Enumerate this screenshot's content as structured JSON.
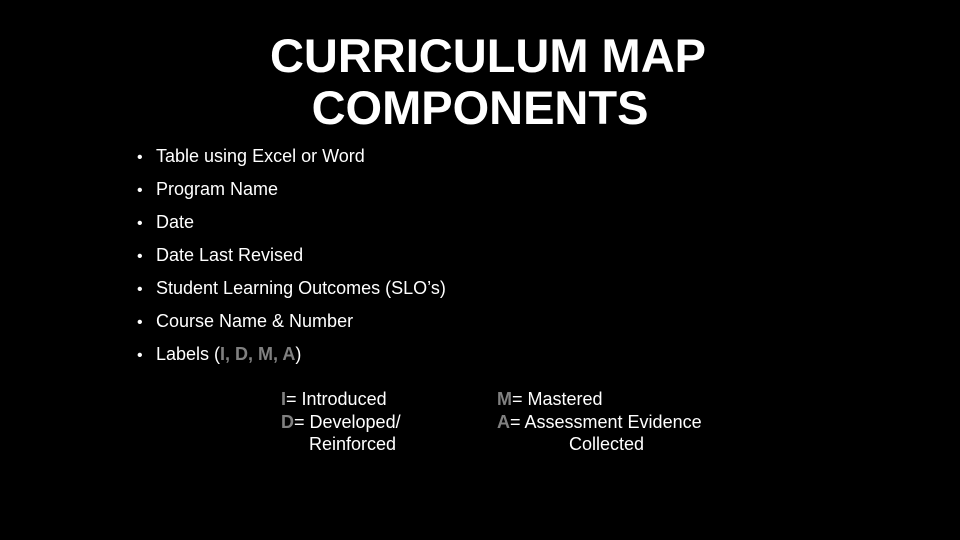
{
  "slide": {
    "title_lines": [
      "CURRICULUM MAP",
      "COMPONENTS"
    ],
    "bullets": [
      {
        "text": "Table using Excel or Word"
      },
      {
        "text": "Program Name"
      },
      {
        "text": "Date"
      },
      {
        "text": "Date Last Revised"
      },
      {
        "text": "Student Learning Outcomes (SLO’s)"
      },
      {
        "text": "Course Name & Number"
      },
      {
        "text": "Labels (",
        "highlight": "I, D, M, A",
        "suffix": ")"
      }
    ],
    "bullet_glyph": "•",
    "legend": {
      "left": [
        {
          "letter": "I",
          "text": "= Introduced"
        },
        {
          "letter": "D",
          "text": "= Developed/",
          "continuation": "Reinforced"
        }
      ],
      "right": [
        {
          "letter": "M",
          "text": "= Mastered"
        },
        {
          "letter": "A",
          "text": "= Assessment Evidence",
          "continuation": "Collected"
        }
      ]
    },
    "colors": {
      "background": "#000000",
      "text": "#ffffff",
      "label_highlight": "#808080"
    }
  }
}
